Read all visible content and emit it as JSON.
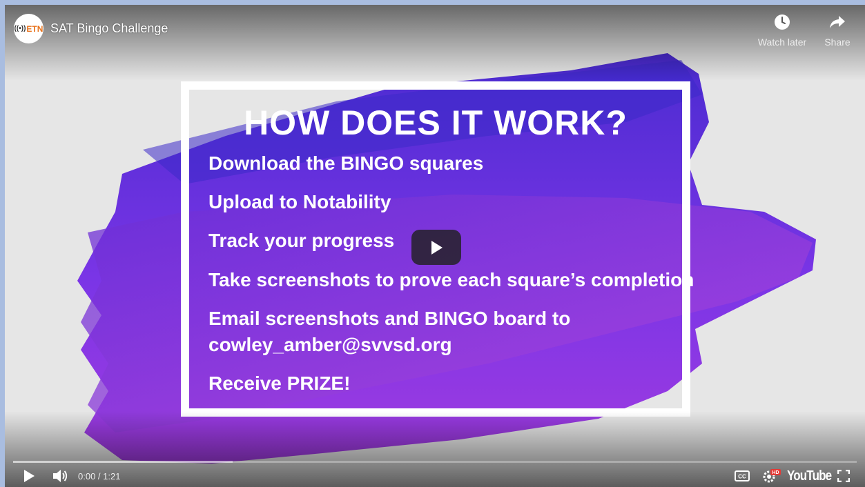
{
  "header": {
    "channel_logo_text": "ETN",
    "title": "SAT Bingo Challenge",
    "watch_later_label": "Watch later",
    "share_label": "Share"
  },
  "slide": {
    "heading": "HOW DOES IT WORK?",
    "lines": [
      "Download the BINGO squares",
      "Upload to Notability",
      "Track your progress",
      "Take screenshots to prove each square’s completion",
      "Email screenshots and BINGO board to",
      "cowley_amber@svvsd.org",
      "Receive PRIZE!"
    ]
  },
  "controls": {
    "time_display": "0:00 / 1:21",
    "hd_badge": "HD",
    "brand_label": "YouTube",
    "buffered_fraction": 0.26
  },
  "colors": {
    "stroke_dark": "#5a26c8",
    "stroke_mid": "#7a35e6",
    "stroke_light": "#9a3fe6",
    "hd_badge": "#e53935"
  }
}
